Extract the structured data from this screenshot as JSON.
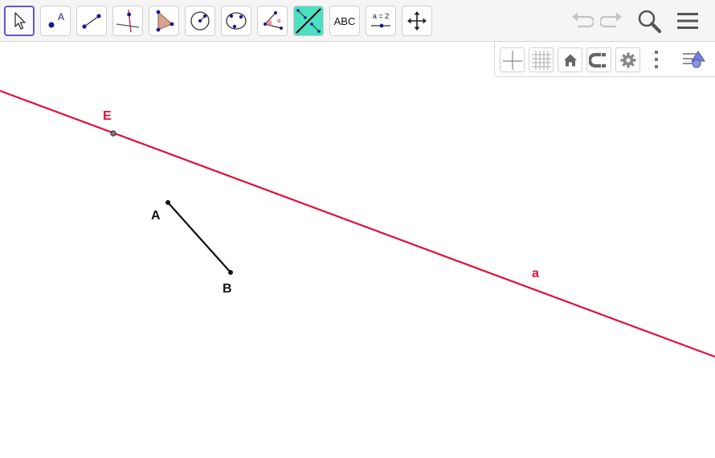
{
  "toolbar": {
    "tools": [
      {
        "name": "move-tool",
        "icon": "arrow-cursor-icon",
        "selected": true
      },
      {
        "name": "point-tool",
        "icon": "point-icon",
        "label": "A"
      },
      {
        "name": "segment-tool",
        "icon": "segment-icon"
      },
      {
        "name": "perpendicular-line-tool",
        "icon": "perpendicular-line-icon"
      },
      {
        "name": "polygon-tool",
        "icon": "polygon-icon"
      },
      {
        "name": "circle-center-point-tool",
        "icon": "circle-center-icon"
      },
      {
        "name": "circle-three-points-tool",
        "icon": "circle-three-points-icon"
      },
      {
        "name": "angle-tool",
        "icon": "angle-icon",
        "label": "α"
      },
      {
        "name": "reflect-about-line-tool",
        "icon": "reflect-line-icon"
      },
      {
        "name": "text-tool",
        "icon": "text-icon",
        "label": "ABC"
      },
      {
        "name": "slider-tool",
        "icon": "slider-icon",
        "label": "a = 2"
      },
      {
        "name": "move-graphics-view-tool",
        "icon": "move-arrows-icon"
      }
    ],
    "right": [
      "undo-icon",
      "redo-icon",
      "search-icon",
      "menu-icon"
    ]
  },
  "stylebar": {
    "buttons": [
      "axes-icon",
      "grid-icon",
      "home-icon",
      "magnet-icon",
      "gear-icon",
      "more-vertical-icon",
      "style-toggle-icon"
    ]
  },
  "colors": {
    "line": "#e0103c",
    "segment": "#111111",
    "selected_border": "#6557d2",
    "reflect_bg": "#4ce0c0"
  },
  "canvas": {
    "labels": {
      "E": "E",
      "A": "A",
      "B": "B",
      "a": "a"
    }
  }
}
